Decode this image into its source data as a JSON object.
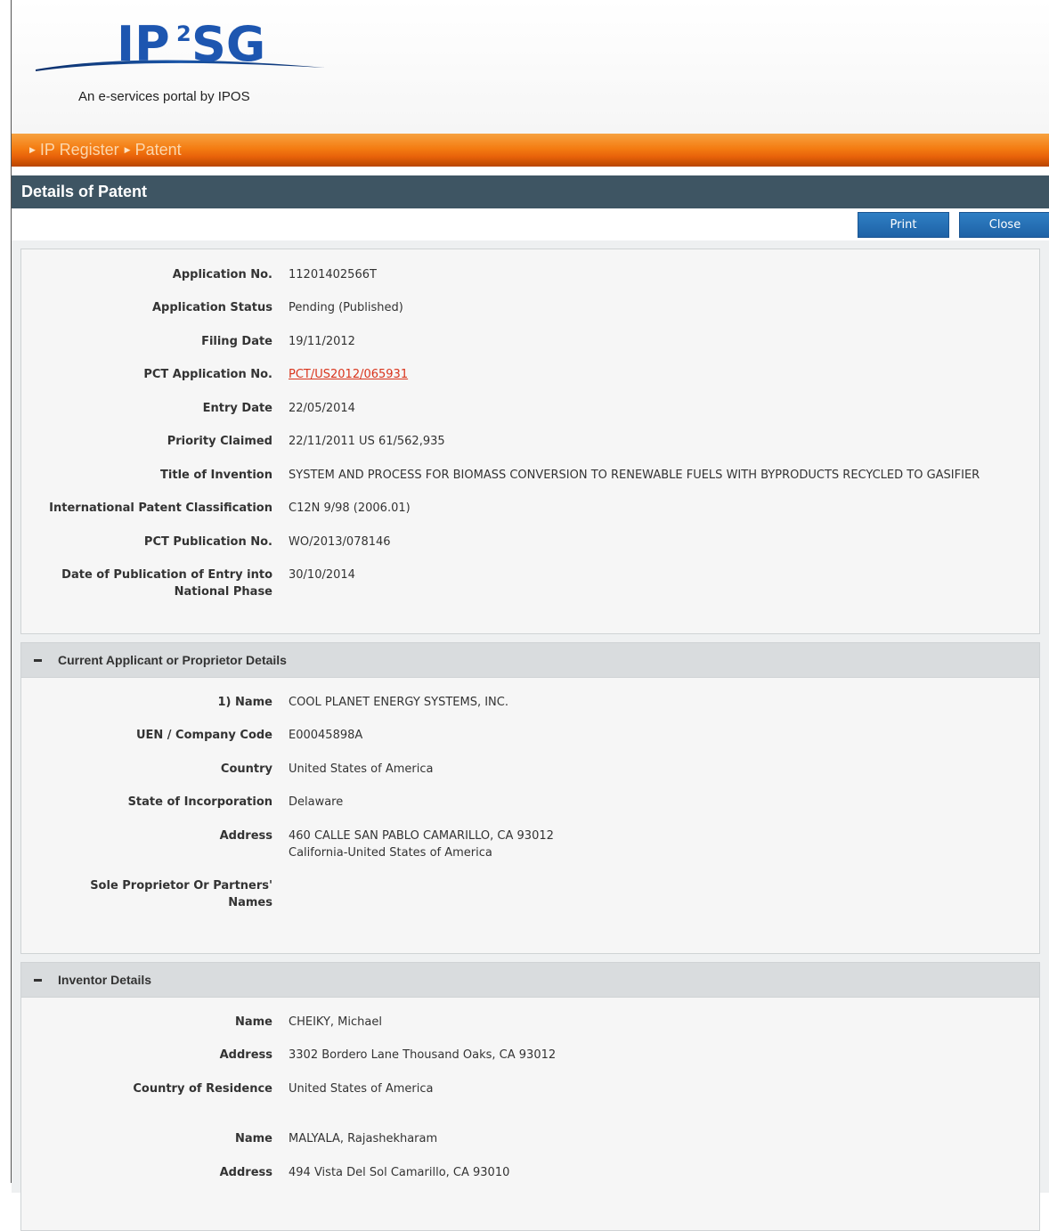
{
  "header": {
    "logo_text": "IP",
    "logo_sup": "2",
    "logo_text2": "SG",
    "tagline": "An e-services portal by IPOS"
  },
  "breadcrumb": [
    "IP Register",
    "Patent"
  ],
  "page_title": "Details of Patent",
  "buttons": {
    "print": "Print",
    "close": "Close"
  },
  "patent": {
    "fields": [
      {
        "label": "Application No.",
        "value": "11201402566T"
      },
      {
        "label": "Application Status",
        "value": "Pending (Published)"
      },
      {
        "label": "Filing Date",
        "value": "19/11/2012"
      },
      {
        "label": "PCT Application No.",
        "value": "PCT/US2012/065931"
      },
      {
        "label": "Entry Date",
        "value": "22/05/2014"
      },
      {
        "label": "Priority Claimed",
        "value": "22/11/2011 US 61/562,935"
      },
      {
        "label": "Title of Invention",
        "value": "SYSTEM AND PROCESS FOR BIOMASS CONVERSION TO RENEWABLE FUELS WITH BYPRODUCTS RECYCLED TO GASIFIER"
      },
      {
        "label": "International Patent Classification",
        "value": "C12N 9/98 (2006.01)"
      },
      {
        "label": "PCT Publication No.",
        "value": "WO/2013/078146"
      },
      {
        "label_line1": "Date of Publication of Entry into",
        "label_line2": "National Phase",
        "value": "30/10/2014"
      }
    ]
  },
  "applicant": {
    "heading": "Current Applicant or Proprietor Details",
    "name_label": "1) Name",
    "name": "COOL PLANET ENERGY SYSTEMS, INC.",
    "uen_label": "UEN / Company Code",
    "uen": "E00045898A",
    "country_label": "Country",
    "country": "United States of America",
    "state_label": "State of Incorporation",
    "state": "Delaware",
    "address_label": "Address",
    "address_line1": "460 CALLE SAN PABLO CAMARILLO, CA 93012",
    "address_line2": "California-United States of America",
    "sole_label_line1": "Sole Proprietor Or Partners'",
    "sole_label_line2": "Names"
  },
  "inventors": {
    "heading": "Inventor Details",
    "list": [
      {
        "name_label": "Name",
        "name": "CHEIKY, Michael",
        "address_label": "Address",
        "address": "3302 Bordero Lane Thousand Oaks, CA 93012",
        "residence_label": "Country of Residence",
        "residence": "United States of America"
      },
      {
        "name_label": "Name",
        "name": "MALYALA, Rajashekharam",
        "address_label": "Address",
        "address": "494 Vista Del Sol Camarillo, CA 93010"
      }
    ]
  }
}
